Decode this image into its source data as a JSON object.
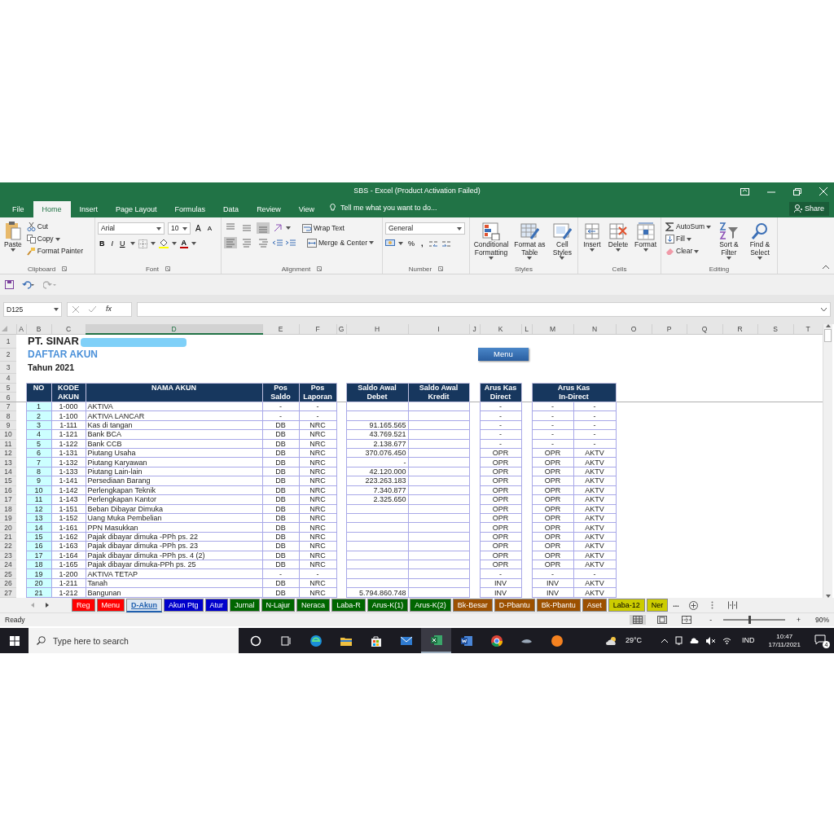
{
  "window": {
    "title": "SBS - Excel (Product Activation Failed)"
  },
  "ribbon_tabs": [
    {
      "label": "File",
      "selected": false
    },
    {
      "label": "Home",
      "selected": true
    },
    {
      "label": "Insert",
      "selected": false
    },
    {
      "label": "Page Layout",
      "selected": false
    },
    {
      "label": "Formulas",
      "selected": false
    },
    {
      "label": "Data",
      "selected": false
    },
    {
      "label": "Review",
      "selected": false
    },
    {
      "label": "View",
      "selected": false
    }
  ],
  "tell_me": {
    "placeholder": "Tell me what you want to do..."
  },
  "share": "Share",
  "ribbon": {
    "clipboard": {
      "paste": "Paste",
      "cut": "Cut",
      "copy": "Copy",
      "format_painter": "Format Painter",
      "label": "Clipboard"
    },
    "font": {
      "name": "Arial",
      "size": "10",
      "grow": "A",
      "shrink": "A",
      "bold": "B",
      "italic": "I",
      "underline": "U",
      "font_color": "A",
      "label": "Font"
    },
    "alignment": {
      "vertical": [
        {
          "kind": "top",
          "selected": false
        },
        {
          "kind": "middle",
          "selected": false
        },
        {
          "kind": "bottom",
          "selected": true
        }
      ],
      "horizontal": [
        {
          "kind": "left",
          "selected": true
        },
        {
          "kind": "center",
          "selected": false
        },
        {
          "kind": "right",
          "selected": false
        }
      ],
      "wrap_text": "Wrap Text",
      "merge_center": "Merge & Center",
      "label": "Alignment"
    },
    "number": {
      "format": "General",
      "percent": "%",
      "comma": ",",
      "label": "Number"
    },
    "styles": {
      "buttons": [
        {
          "kind": "conditional",
          "label": "Conditional Formatting"
        },
        {
          "kind": "table",
          "label": "Format as Table"
        },
        {
          "kind": "cell",
          "label": "Cell Styles"
        }
      ],
      "label": "Styles"
    },
    "cells": {
      "buttons": [
        {
          "kind": "insert",
          "label": "Insert"
        },
        {
          "kind": "delete",
          "label": "Delete"
        },
        {
          "kind": "format",
          "label": "Format"
        }
      ],
      "label": "Cells"
    },
    "editing": {
      "autosum": "AutoSum",
      "fill": "Fill",
      "clear": "Clear",
      "buttons": [
        {
          "kind": "sort",
          "label": "Sort & Filter"
        },
        {
          "kind": "find",
          "label": "Find & Select"
        }
      ],
      "label": "Editing"
    }
  },
  "formula_bar": {
    "name_box": "D125",
    "fx": "fx"
  },
  "columns": [
    {
      "label": "A",
      "selected": false
    },
    {
      "label": "B",
      "selected": false
    },
    {
      "label": "C",
      "selected": false
    },
    {
      "label": "D",
      "selected": true
    },
    {
      "label": "E",
      "selected": false
    },
    {
      "label": "F",
      "selected": false
    },
    {
      "label": "G",
      "selected": false
    },
    {
      "label": "H",
      "selected": false
    },
    {
      "label": "I",
      "selected": false
    },
    {
      "label": "J",
      "selected": false
    },
    {
      "label": "K",
      "selected": false
    },
    {
      "label": "L",
      "selected": false
    },
    {
      "label": "M",
      "selected": false
    },
    {
      "label": "N",
      "selected": false
    },
    {
      "label": "O",
      "selected": false
    },
    {
      "label": "P",
      "selected": false
    },
    {
      "label": "Q",
      "selected": false
    },
    {
      "label": "R",
      "selected": false
    },
    {
      "label": "S",
      "selected": false
    },
    {
      "label": "T",
      "selected": false
    }
  ],
  "row_numbers": [
    "1",
    "2",
    "3",
    "4",
    "5",
    "6",
    "7",
    "8",
    "9",
    "10",
    "11",
    "12",
    "13",
    "14",
    "15",
    "16",
    "17",
    "18",
    "19",
    "20",
    "21",
    "22",
    "23",
    "24",
    "25",
    "26",
    "27"
  ],
  "sheet": {
    "company": "PT. SINAR",
    "title": "DAFTAR AKUN",
    "year": "Tahun 2021",
    "menu_button": "Menu",
    "headers": {
      "no": [
        "NO"
      ],
      "kode": [
        "KODE",
        "AKUN"
      ],
      "nama": [
        "NAMA AKUN"
      ],
      "pos_saldo": [
        "Pos",
        "Saldo"
      ],
      "pos_laporan": [
        "Pos",
        "Laporan"
      ],
      "debet": [
        "Saldo Awal",
        "Debet"
      ],
      "kredit": [
        "Saldo Awal",
        "Kredit"
      ],
      "direct": [
        "Arus Kas",
        "Direct"
      ],
      "indirect": [
        "Arus Kas",
        "In-Direct"
      ]
    },
    "rows": [
      {
        "no": "1",
        "kode": "1-000",
        "nama": "AKTIVA",
        "pos_saldo": "-",
        "pos_laporan": "-",
        "direct": "-",
        "indirect_1": "-",
        "indirect_2": "-"
      },
      {
        "no": "2",
        "kode": "1-100",
        "nama": "AKTIVA LANCAR",
        "pos_saldo": "-",
        "pos_laporan": "-",
        "direct": "-",
        "indirect_1": "-",
        "indirect_2": "-"
      },
      {
        "no": "3",
        "kode": "1-111",
        "nama": "Kas di tangan",
        "pos_saldo": "DB",
        "pos_laporan": "NRC",
        "debet": "91.165.565",
        "direct": "-",
        "indirect_1": "-",
        "indirect_2": "-"
      },
      {
        "no": "4",
        "kode": "1-121",
        "nama": "Bank BCA",
        "pos_saldo": "DB",
        "pos_laporan": "NRC",
        "debet": "43.769.521",
        "direct": "-",
        "indirect_1": "-",
        "indirect_2": "-"
      },
      {
        "no": "5",
        "kode": "1-122",
        "nama": "Bank CCB",
        "pos_saldo": "DB",
        "pos_laporan": "NRC",
        "debet": "2.138.677",
        "direct": "-",
        "indirect_1": "-",
        "indirect_2": "-"
      },
      {
        "no": "6",
        "kode": "1-131",
        "nama": "Piutang Usaha",
        "pos_saldo": "DB",
        "pos_laporan": "NRC",
        "debet": "370.076.450",
        "direct": "OPR",
        "indirect_1": "OPR",
        "indirect_2": "AKTV"
      },
      {
        "no": "7",
        "kode": "1-132",
        "nama": "Piutang Karyawan",
        "pos_saldo": "DB",
        "pos_laporan": "NRC",
        "debet": "-",
        "direct": "OPR",
        "indirect_1": "OPR",
        "indirect_2": "AKTV"
      },
      {
        "no": "8",
        "kode": "1-133",
        "nama": "Piutang Lain-lain",
        "pos_saldo": "DB",
        "pos_laporan": "NRC",
        "debet": "42.120.000",
        "direct": "OPR",
        "indirect_1": "OPR",
        "indirect_2": "AKTV"
      },
      {
        "no": "9",
        "kode": "1-141",
        "nama": "Persediaan Barang",
        "pos_saldo": "DB",
        "pos_laporan": "NRC",
        "debet": "223.263.183",
        "direct": "OPR",
        "indirect_1": "OPR",
        "indirect_2": "AKTV"
      },
      {
        "no": "10",
        "kode": "1-142",
        "nama": "Perlengkapan Teknik",
        "pos_saldo": "DB",
        "pos_laporan": "NRC",
        "debet": "7.340.877",
        "direct": "OPR",
        "indirect_1": "OPR",
        "indirect_2": "AKTV"
      },
      {
        "no": "11",
        "kode": "1-143",
        "nama": "Perlengkapan Kantor",
        "pos_saldo": "DB",
        "pos_laporan": "NRC",
        "debet": "2.325.650",
        "direct": "OPR",
        "indirect_1": "OPR",
        "indirect_2": "AKTV"
      },
      {
        "no": "12",
        "kode": "1-151",
        "nama": "Beban Dibayar Dimuka",
        "pos_saldo": "DB",
        "pos_laporan": "NRC",
        "direct": "OPR",
        "indirect_1": "OPR",
        "indirect_2": "AKTV"
      },
      {
        "no": "13",
        "kode": "1-152",
        "nama": "Uang Muka Pembelian",
        "pos_saldo": "DB",
        "pos_laporan": "NRC",
        "direct": "OPR",
        "indirect_1": "OPR",
        "indirect_2": "AKTV"
      },
      {
        "no": "14",
        "kode": "1-161",
        "nama": "PPN Masukkan",
        "pos_saldo": "DB",
        "pos_laporan": "NRC",
        "direct": "OPR",
        "indirect_1": "OPR",
        "indirect_2": "AKTV"
      },
      {
        "no": "15",
        "kode": "1-162",
        "nama": "Pajak dibayar dimuka -PPh ps. 22",
        "pos_saldo": "DB",
        "pos_laporan": "NRC",
        "direct": "OPR",
        "indirect_1": "OPR",
        "indirect_2": "AKTV"
      },
      {
        "no": "16",
        "kode": "1-163",
        "nama": "Pajak dibayar dimuka -PPh ps. 23",
        "pos_saldo": "DB",
        "pos_laporan": "NRC",
        "direct": "OPR",
        "indirect_1": "OPR",
        "indirect_2": "AKTV"
      },
      {
        "no": "17",
        "kode": "1-164",
        "nama": "Pajak dibayar dimuka -PPh ps. 4 (2)",
        "pos_saldo": "DB",
        "pos_laporan": "NRC",
        "direct": "OPR",
        "indirect_1": "OPR",
        "indirect_2": "AKTV"
      },
      {
        "no": "18",
        "kode": "1-165",
        "nama": "Pajak dibayar dimuka-PPh ps. 25",
        "pos_saldo": "DB",
        "pos_laporan": "NRC",
        "direct": "OPR",
        "indirect_1": "OPR",
        "indirect_2": "AKTV"
      },
      {
        "no": "19",
        "kode": "1-200",
        "nama": "AKTIVA TETAP",
        "pos_saldo": "-",
        "pos_laporan": "-",
        "direct": "-",
        "indirect_1": "-",
        "indirect_2": "-"
      },
      {
        "no": "20",
        "kode": "1-211",
        "nama": "Tanah",
        "pos_saldo": "DB",
        "pos_laporan": "NRC",
        "direct": "INV",
        "indirect_1": "INV",
        "indirect_2": "AKTV"
      },
      {
        "no": "21",
        "kode": "1-212",
        "nama": "Bangunan",
        "pos_saldo": "DB",
        "pos_laporan": "NRC",
        "debet": "5.794.860.748",
        "direct": "INV",
        "indirect_1": "INV",
        "indirect_2": "AKTV"
      }
    ]
  },
  "sheet_tabs": [
    {
      "label": "Reg",
      "color": "#ff0000",
      "selected": false
    },
    {
      "label": "Menu",
      "color": "#ff0000",
      "selected": false
    },
    {
      "label": "D-Akun",
      "color": "#dce6f2",
      "selected": true
    },
    {
      "label": "Akun Ptg",
      "color": "#0000cc",
      "selected": false
    },
    {
      "label": "Atur",
      "color": "#0000cc",
      "selected": false
    },
    {
      "label": "Jurnal",
      "color": "#006600",
      "selected": false
    },
    {
      "label": "N-Lajur",
      "color": "#006600",
      "selected": false
    },
    {
      "label": "Neraca",
      "color": "#006600",
      "selected": false
    },
    {
      "label": "Laba-R",
      "color": "#006600",
      "selected": false
    },
    {
      "label": "Arus-K(1)",
      "color": "#006600",
      "selected": false
    },
    {
      "label": "Arus-K(2)",
      "color": "#006600",
      "selected": false
    },
    {
      "label": "Bk-Besar",
      "color": "#9c5000",
      "selected": false
    },
    {
      "label": "D-Pbantu",
      "color": "#9c5000",
      "selected": false
    },
    {
      "label": "Bk-Pbantu",
      "color": "#9c5000",
      "selected": false
    },
    {
      "label": "Aset",
      "color": "#9c5000",
      "selected": false
    },
    {
      "label": "Laba-12",
      "color": "#cccc00",
      "selected": false
    },
    {
      "label": "Ner",
      "color": "#cccc00",
      "selected": false
    }
  ],
  "sheet_tabs_more": "...",
  "status_bar": {
    "text": "Ready",
    "views": [
      {
        "kind": "normal",
        "selected": true
      },
      {
        "kind": "page_layout",
        "selected": false
      },
      {
        "kind": "page_break",
        "selected": false
      }
    ],
    "zoom_out": "-",
    "zoom_in": "+",
    "zoom": {
      "level": 0.43
    },
    "zoom_text": "90%"
  },
  "taskbar": {
    "search": {
      "placeholder": "Type here to search"
    },
    "apps": [
      {
        "kind": "cortana",
        "active": false
      },
      {
        "kind": "taskview",
        "active": false
      },
      {
        "kind": "edge",
        "active": false
      },
      {
        "kind": "explorer",
        "active": false
      },
      {
        "kind": "store",
        "active": false
      },
      {
        "kind": "mail",
        "active": false
      },
      {
        "kind": "excel",
        "active": true
      },
      {
        "kind": "word",
        "active": false
      },
      {
        "kind": "chrome",
        "active": false
      },
      {
        "kind": "generic",
        "active": false
      },
      {
        "kind": "orange",
        "active": false
      }
    ],
    "temperature": "29°C",
    "language": "IND",
    "time": "10:47",
    "date": "17/11/2021",
    "notifications": "4"
  }
}
